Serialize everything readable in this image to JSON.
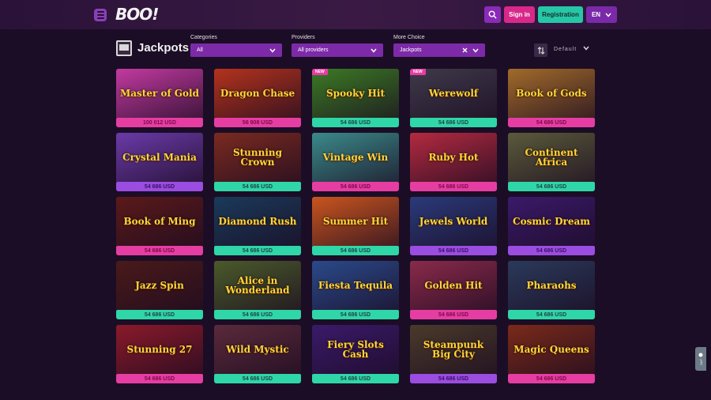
{
  "header": {
    "logo": "BOO!",
    "signin": "Sign in",
    "registration": "Registration",
    "lang": "EN"
  },
  "page": {
    "title": "Jackpots"
  },
  "filters": {
    "categories_label": "Categories",
    "categories_value": "All",
    "providers_label": "Providers",
    "providers_value": "All providers",
    "more_label": "More Choice",
    "more_value": "Jackpots",
    "sort_value": "Default"
  },
  "live_chat": "24/7",
  "games": [
    {
      "name": "Master of Gold",
      "jackpot": "100 012 USD",
      "style": "pink",
      "bg": "#c23aa0",
      "new": ""
    },
    {
      "name": "Dragon Chase",
      "jackpot": "56 908 USD",
      "style": "pink",
      "bg": "#b3331d",
      "new": ""
    },
    {
      "name": "Spooky Hit",
      "jackpot": "54 686 USD",
      "style": "green",
      "bg": "#3b7a24",
      "new": "NEW"
    },
    {
      "name": "Werewolf",
      "jackpot": "54 686 USD",
      "style": "green",
      "bg": "#3e3a4a",
      "new": "NEW"
    },
    {
      "name": "Book of Gods",
      "jackpot": "54 686 USD",
      "style": "pink",
      "bg": "#a16a2a",
      "new": ""
    },
    {
      "name": "Crystal Mania",
      "jackpot": "54 686 USD",
      "style": "purple",
      "bg": "#6a3aa8",
      "new": ""
    },
    {
      "name": "Stunning Crown",
      "jackpot": "54 686 USD",
      "style": "green",
      "bg": "#7a2a20",
      "new": ""
    },
    {
      "name": "Vintage Win",
      "jackpot": "54 686 USD",
      "style": "pink",
      "bg": "#3a8a8a",
      "new": ""
    },
    {
      "name": "Ruby Hot",
      "jackpot": "54 686 USD",
      "style": "pink",
      "bg": "#b32a40",
      "new": ""
    },
    {
      "name": "Continent Africa",
      "jackpot": "54 686 USD",
      "style": "green",
      "bg": "#5a5a3a",
      "new": ""
    },
    {
      "name": "Book of Ming",
      "jackpot": "54 686 USD",
      "style": "pink",
      "bg": "#5a1a1a",
      "new": ""
    },
    {
      "name": "Diamond Rush",
      "jackpot": "54 686 USD",
      "style": "green",
      "bg": "#1a3a5a",
      "new": ""
    },
    {
      "name": "Summer Hit",
      "jackpot": "54 686 USD",
      "style": "green",
      "bg": "#c9551f",
      "new": ""
    },
    {
      "name": "Jewels World",
      "jackpot": "54 686 USD",
      "style": "purple",
      "bg": "#2a3a7a",
      "new": ""
    },
    {
      "name": "Cosmic Dream",
      "jackpot": "54 686 USD",
      "style": "purple",
      "bg": "#3a1a6a",
      "new": ""
    },
    {
      "name": "Jazz Spin",
      "jackpot": "54 686 USD",
      "style": "green",
      "bg": "#4a1a1a",
      "new": ""
    },
    {
      "name": "Alice in Wonderland",
      "jackpot": "54 686 USD",
      "style": "green",
      "bg": "#4a5a2a",
      "new": ""
    },
    {
      "name": "Fiesta Tequila",
      "jackpot": "54 686 USD",
      "style": "green",
      "bg": "#2a4a8a",
      "new": ""
    },
    {
      "name": "Golden Hit",
      "jackpot": "54 686 USD",
      "style": "pink",
      "bg": "#8a2a4a",
      "new": ""
    },
    {
      "name": "Pharaohs",
      "jackpot": "54 686 USD",
      "style": "green",
      "bg": "#2a3a5a",
      "new": ""
    },
    {
      "name": "Stunning 27",
      "jackpot": "54 686 USD",
      "style": "pink",
      "bg": "#8a1a2a",
      "new": ""
    },
    {
      "name": "Wild Mystic",
      "jackpot": "54 686 USD",
      "style": "green",
      "bg": "#5a2a3a",
      "new": ""
    },
    {
      "name": "Fiery Slots Cash",
      "jackpot": "54 686 USD",
      "style": "green",
      "bg": "#3a1a6a",
      "new": ""
    },
    {
      "name": "Steampunk Big City",
      "jackpot": "54 686 USD",
      "style": "purple",
      "bg": "#4a3a2a",
      "new": ""
    },
    {
      "name": "Magic Queens",
      "jackpot": "54 686 USD",
      "style": "pink",
      "bg": "#7a2a1a",
      "new": ""
    }
  ]
}
